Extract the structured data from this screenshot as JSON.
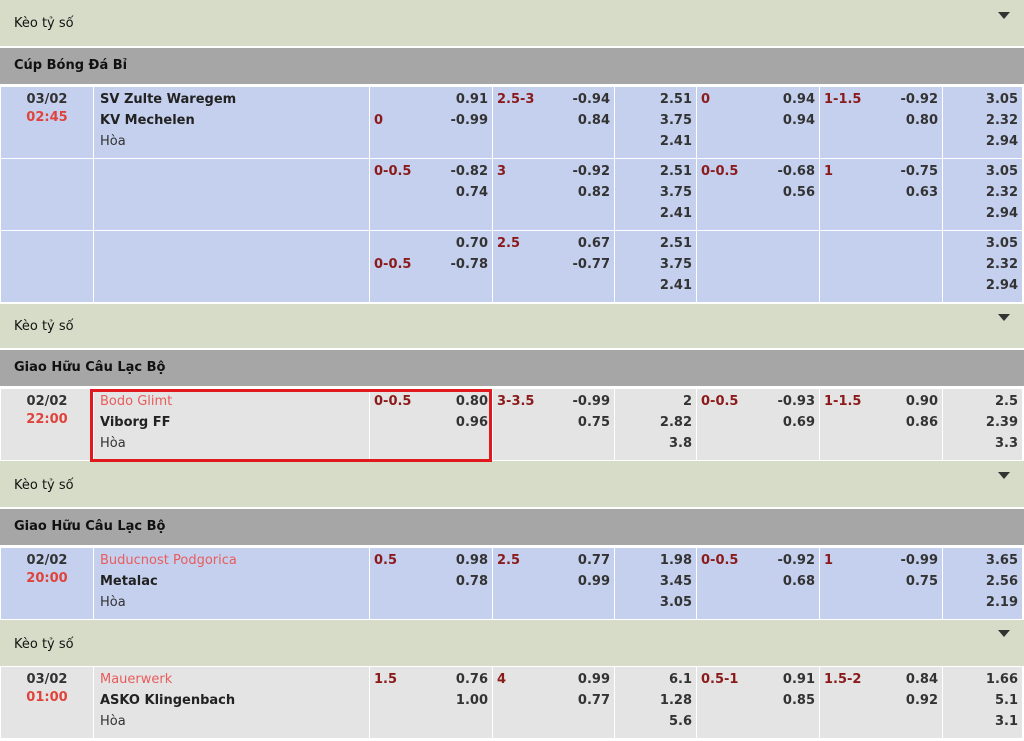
{
  "score_label": "Kèo tỷ số",
  "blocks": [
    {
      "league": "Cúp Bóng Đá Bỉ",
      "theme": "blue",
      "rows": [
        {
          "date": "03/02",
          "time": "02:45",
          "home": "SV Zulte Waregem",
          "away": "KV Mechelen",
          "draw": "Hòa",
          "home_fav": false,
          "ah_line_home": "",
          "ah_line_away": "0",
          "ah_home": "0.91",
          "ah_away": "-0.99",
          "ou_line": "2.5-3",
          "ou_over": "-0.94",
          "ou_under": "0.84",
          "x12": [
            "2.51",
            "3.75",
            "2.41"
          ],
          "h1_ah_line_home": "0",
          "h1_ah_line_away": "",
          "h1_ah_home": "0.94",
          "h1_ah_away": "0.94",
          "h1_ou_line": "1-1.5",
          "h1_ou_over": "-0.92",
          "h1_ou_under": "0.80",
          "h1_x12": [
            "3.05",
            "2.32",
            "2.94"
          ]
        },
        {
          "date": "",
          "time": "",
          "home": "",
          "away": "",
          "draw": "",
          "home_fav": false,
          "ah_line_home": "0-0.5",
          "ah_line_away": "",
          "ah_home": "-0.82",
          "ah_away": "0.74",
          "ou_line": "3",
          "ou_over": "-0.92",
          "ou_under": "0.82",
          "x12": [
            "2.51",
            "3.75",
            "2.41"
          ],
          "h1_ah_line_home": "0-0.5",
          "h1_ah_line_away": "",
          "h1_ah_home": "-0.68",
          "h1_ah_away": "0.56",
          "h1_ou_line": "1",
          "h1_ou_over": "-0.75",
          "h1_ou_under": "0.63",
          "h1_x12": [
            "3.05",
            "2.32",
            "2.94"
          ]
        },
        {
          "date": "",
          "time": "",
          "home": "",
          "away": "",
          "draw": "",
          "home_fav": false,
          "ah_line_home": "",
          "ah_line_away": "0-0.5",
          "ah_home": "0.70",
          "ah_away": "-0.78",
          "ou_line": "2.5",
          "ou_over": "0.67",
          "ou_under": "-0.77",
          "x12": [
            "2.51",
            "3.75",
            "2.41"
          ],
          "h1_ah_line_home": "",
          "h1_ah_line_away": "",
          "h1_ah_home": "",
          "h1_ah_away": "",
          "h1_ou_line": "",
          "h1_ou_over": "",
          "h1_ou_under": "",
          "h1_x12": [
            "3.05",
            "2.32",
            "2.94"
          ]
        }
      ]
    },
    {
      "league": "Giao Hữu Câu Lạc Bộ",
      "theme": "gray",
      "rows": [
        {
          "date": "02/02",
          "time": "22:00",
          "home": "Bodo Glimt",
          "away": "Viborg FF",
          "draw": "Hòa",
          "home_fav": true,
          "ah_line_home": "0-0.5",
          "ah_line_away": "",
          "ah_home": "0.80",
          "ah_away": "0.96",
          "ou_line": "3-3.5",
          "ou_over": "-0.99",
          "ou_under": "0.75",
          "x12": [
            "2",
            "2.82",
            "3.8"
          ],
          "h1_ah_line_home": "0-0.5",
          "h1_ah_line_away": "",
          "h1_ah_home": "-0.93",
          "h1_ah_away": "0.69",
          "h1_ou_line": "1-1.5",
          "h1_ou_over": "0.90",
          "h1_ou_under": "0.86",
          "h1_x12": [
            "2.5",
            "2.39",
            "3.3"
          ]
        }
      ]
    },
    {
      "league": "Giao Hữu Câu Lạc Bộ",
      "theme": "blue",
      "rows": [
        {
          "date": "02/02",
          "time": "20:00",
          "home": "Buducnost Podgorica",
          "away": "Metalac",
          "draw": "Hòa",
          "home_fav": true,
          "ah_line_home": "0.5",
          "ah_line_away": "",
          "ah_home": "0.98",
          "ah_away": "0.78",
          "ou_line": "2.5",
          "ou_over": "0.77",
          "ou_under": "0.99",
          "x12": [
            "1.98",
            "3.45",
            "3.05"
          ],
          "h1_ah_line_home": "0-0.5",
          "h1_ah_line_away": "",
          "h1_ah_home": "-0.92",
          "h1_ah_away": "0.68",
          "h1_ou_line": "1",
          "h1_ou_over": "-0.99",
          "h1_ou_under": "0.75",
          "h1_x12": [
            "3.65",
            "2.56",
            "2.19"
          ]
        }
      ]
    },
    {
      "league": "",
      "theme": "gray",
      "rows": [
        {
          "date": "03/02",
          "time": "01:00",
          "home": "Mauerwerk",
          "away": "ASKO Klingenbach",
          "draw": "Hòa",
          "home_fav": true,
          "ah_line_home": "1.5",
          "ah_line_away": "",
          "ah_home": "0.76",
          "ah_away": "1.00",
          "ou_line": "4",
          "ou_over": "0.99",
          "ou_under": "0.77",
          "x12": [
            "6.1",
            "1.28",
            "5.6"
          ],
          "h1_ah_line_home": "0.5-1",
          "h1_ah_line_away": "",
          "h1_ah_home": "0.91",
          "h1_ah_away": "0.85",
          "h1_ou_line": "1.5-2",
          "h1_ou_over": "0.84",
          "h1_ou_under": "0.92",
          "h1_x12": [
            "1.66",
            "5.1",
            "3.1"
          ]
        }
      ]
    }
  ]
}
